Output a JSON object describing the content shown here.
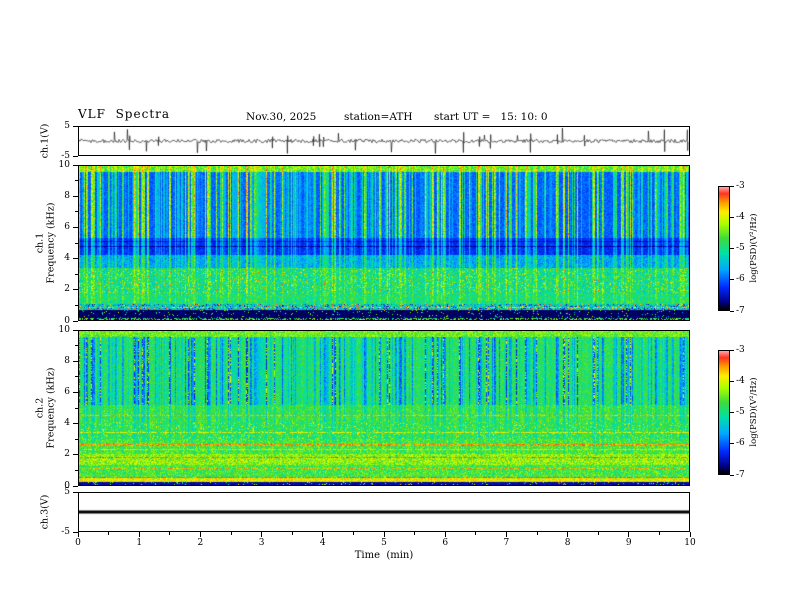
{
  "header": {
    "title": "VLF  Spectra",
    "date": "Nov.30, 2025",
    "station": "station=ATH",
    "start_ut": "start UT =   15: 10: 0"
  },
  "x_axis": {
    "label": "Time  (min)",
    "ticks": [
      "0",
      "1",
      "2",
      "3",
      "4",
      "5",
      "6",
      "7",
      "8",
      "9",
      "10"
    ],
    "range": [
      0,
      10
    ]
  },
  "panels": {
    "ch1_wave": {
      "ylabel": "ch.1(V)",
      "yticks": [
        "5",
        "-5"
      ],
      "ylim": [
        -5,
        5
      ]
    },
    "ch1_spec": {
      "ylabel_line1": "ch.1",
      "ylabel_line2": "Frequency  (kHz)",
      "yticks": [
        "10",
        "8",
        "6",
        "4",
        "2",
        "0"
      ],
      "ylim": [
        0,
        10
      ]
    },
    "ch2_spec": {
      "ylabel_line1": "ch.2",
      "ylabel_line2": "Frequency  (kHz)",
      "yticks": [
        "10",
        "8",
        "6",
        "4",
        "2",
        "0"
      ],
      "ylim": [
        0,
        10
      ]
    },
    "ch3_wave": {
      "ylabel": "ch.3(V)",
      "yticks": [
        "5",
        "-5"
      ],
      "ylim": [
        -5,
        5
      ]
    }
  },
  "colorbar": {
    "label": "log(PSD)(V²/Hz)",
    "ticks": [
      "-3",
      "-4",
      "-5",
      "-6",
      "-7"
    ],
    "range": [
      -7,
      -3
    ]
  },
  "colormap": {
    "stops": [
      [
        0,
        "#000000"
      ],
      [
        0.06,
        "#000085"
      ],
      [
        0.18,
        "#0028FF"
      ],
      [
        0.33,
        "#00AAFF"
      ],
      [
        0.46,
        "#00E0A8"
      ],
      [
        0.58,
        "#3CDC3C"
      ],
      [
        0.7,
        "#AAFF00"
      ],
      [
        0.8,
        "#FFEE00"
      ],
      [
        0.88,
        "#FF9900"
      ],
      [
        0.95,
        "#FF3220"
      ],
      [
        1,
        "#FFA0A0"
      ]
    ]
  },
  "chart_data": [
    {
      "type": "line",
      "title": "ch.1 voltage waveform",
      "xlabel": "Time (min)",
      "xlim": [
        0,
        10
      ],
      "ylabel": "ch.1(V)",
      "ylim": [
        -5,
        5
      ],
      "series": [
        {
          "name": "ch.1",
          "summary": "continuous broadband noise of roughly ±1 V about 0 V with frequent impulsive sferic spikes reaching about ±5 V, fairly uniform across the whole 0–10 min record"
        }
      ]
    },
    {
      "type": "heatmap",
      "title": "ch.1 spectrogram",
      "xlabel": "Time (min)",
      "xlim": [
        0,
        10
      ],
      "ylabel": "Frequency (kHz)",
      "ylim": [
        0,
        10
      ],
      "zlabel": "log(PSD)(V²/Hz)",
      "zlim": [
        -7,
        -3
      ],
      "legend_position": "right colorbar",
      "features": [
        "5–10 kHz: blue background near -6.2 crossed by dense vertical sferic streaks rising to about -4.5 (green/yellow), spaced a few seconds apart for the full 10 min",
        "4.3–5.2 kHz: darker blue horizontal band near -6.6",
        "1–3.5 kHz: cyan/green mottled band around -5.2 with brighter green-yellow patches near -4.5",
        "0.6–1 kHz: mixed green and red speckle with an intermittent red line near 0.8 kHz at about -3.5",
        "0.15–0.6 kHz: black band near -7 with sparse colored speckles",
        "thin green-yellow line along the 10 kHz top edge near -4.7"
      ]
    },
    {
      "type": "heatmap",
      "title": "ch.2 spectrogram",
      "xlabel": "Time (min)",
      "xlim": [
        0,
        10
      ],
      "ylabel": "Frequency (kHz)",
      "ylim": [
        0,
        10
      ],
      "zlabel": "log(PSD)(V²/Hz)",
      "zlim": [
        -7,
        -3
      ],
      "legend_position": "right colorbar",
      "features": [
        "5–10 kHz: green background near -5 crossed by dark blue vertical stripes near -6 occurring at the same times as the ch.1 sferic streaks",
        "2–5 kHz: green/yellow mottle around -4.8",
        "narrowband horizontal interference lines near 0.5, 1.1, 1.5, 1.8, 2.3, 2.6, 3.4 and 4.5 kHz at about -3.5 to -3 (orange/red), dashed along time",
        "0.2–0.6 kHz: bright yellow-orange band near -3.8",
        "0–0.2 kHz: black band near -7"
      ]
    },
    {
      "type": "line",
      "title": "ch.3 voltage waveform",
      "xlabel": "Time (min)",
      "xlim": [
        0,
        10
      ],
      "ylabel": "ch.3(V)",
      "ylim": [
        -5,
        5
      ],
      "series": [
        {
          "name": "ch.3",
          "summary": "constant 0 V flat line across the entire record (dead/off channel)"
        }
      ]
    }
  ]
}
